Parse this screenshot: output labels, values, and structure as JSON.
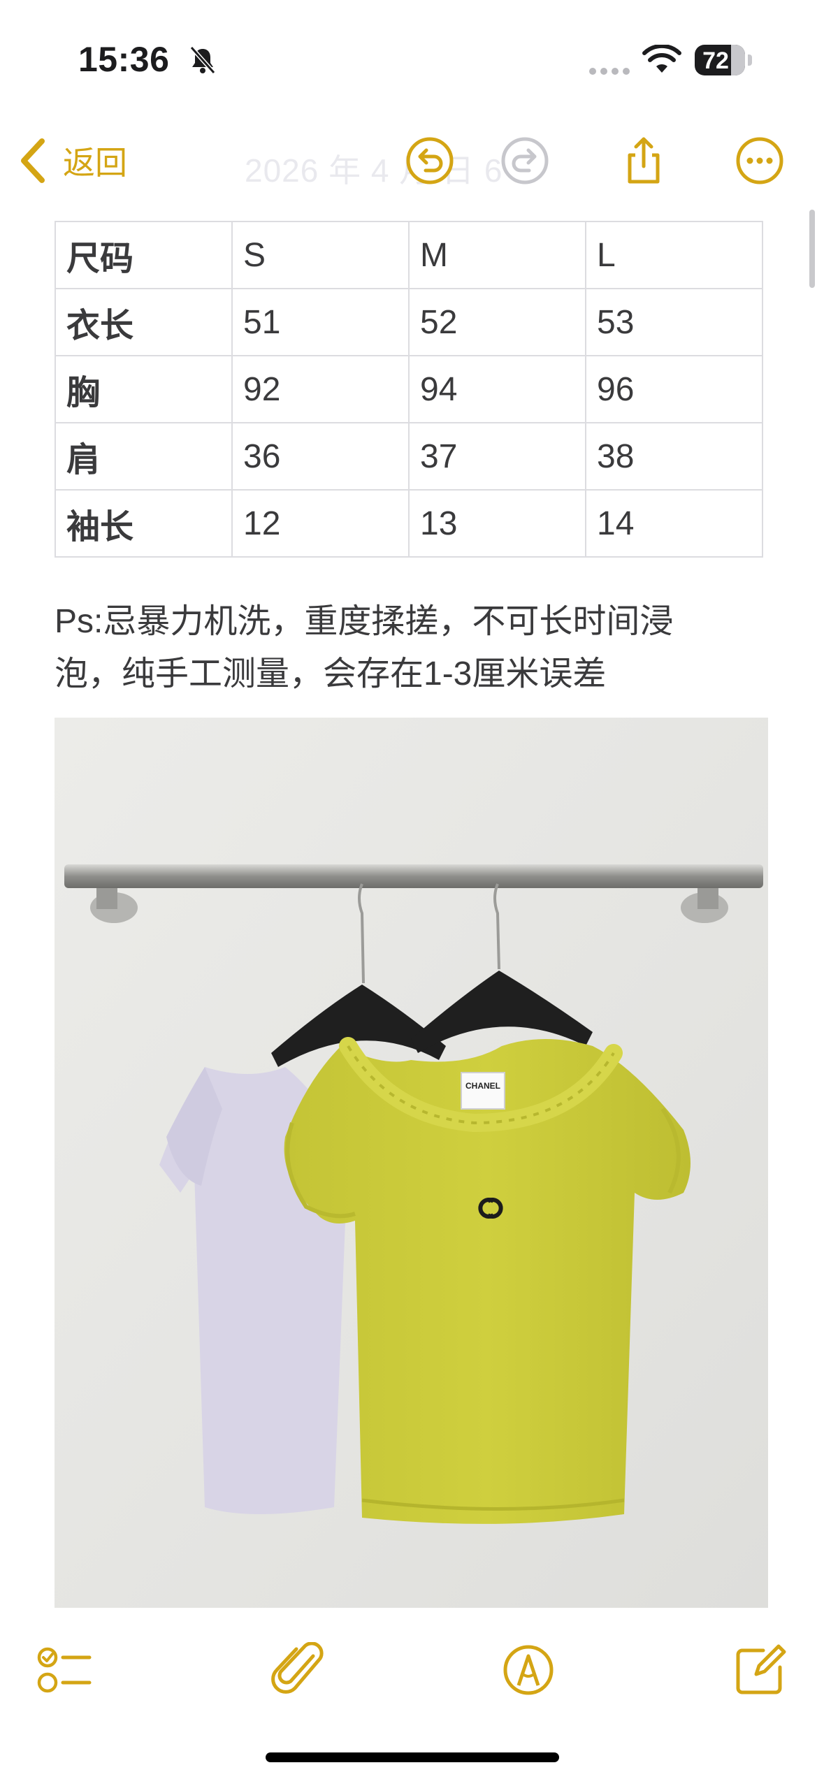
{
  "status_bar": {
    "time": "15:36",
    "battery_level": "72",
    "battery_fraction": 0.72,
    "icons": [
      "bell-slash-icon",
      "cellular-dots-icon",
      "wifi-icon",
      "battery-icon"
    ]
  },
  "nav": {
    "back_label": "返回",
    "date_text": "2026 年 4 月  日  6",
    "icons": [
      "chevron-left-icon",
      "undo-icon",
      "redo-icon",
      "share-icon",
      "more-icon"
    ],
    "accent_color": "#d4a514"
  },
  "size_table": {
    "header": [
      "尺码",
      "S",
      "M",
      "L"
    ],
    "rows": [
      [
        "衣长",
        "51",
        "52",
        "53"
      ],
      [
        "胸",
        "92",
        "94",
        "96"
      ],
      [
        "肩",
        "36",
        "37",
        "38"
      ],
      [
        "袖长",
        "12",
        "13",
        "14"
      ]
    ]
  },
  "note": {
    "line1": "Ps:忌暴力机洗，重度揉搓，不可长时间浸",
    "line2": "泡，纯手工测量，会存在1-3厘米误差"
  },
  "photo": {
    "label_text": "CHANEL",
    "colors": {
      "wall": "#e9e9e6",
      "yellow_top": "#c9c93a",
      "lavender_top": "#d8d4e6"
    }
  },
  "toolbar": {
    "icons": [
      "checklist-icon",
      "paperclip-icon",
      "markup-pen-icon",
      "compose-icon"
    ]
  }
}
